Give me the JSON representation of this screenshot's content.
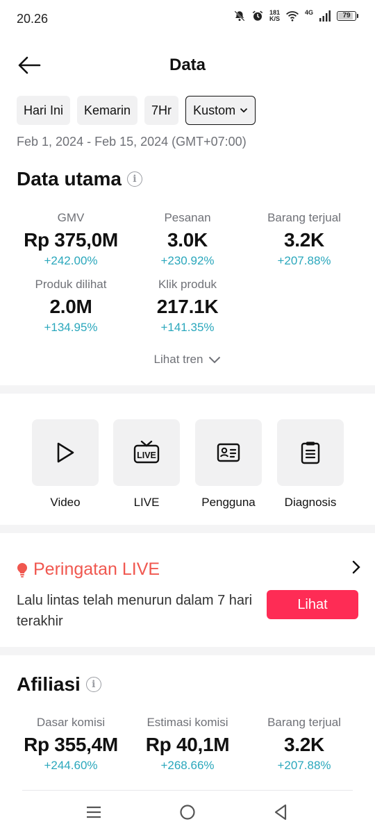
{
  "status": {
    "time": "20.26",
    "net_speed": "181",
    "net_unit": "K/S",
    "network": "4G",
    "battery": "79"
  },
  "header": {
    "title": "Data"
  },
  "date_chips": [
    {
      "label": "Hari Ini"
    },
    {
      "label": "Kemarin"
    },
    {
      "label": "7Hr"
    },
    {
      "label": "Kustom"
    }
  ],
  "date_range": "Feb 1, 2024 - Feb 15, 2024 (GMT+07:00)",
  "main_data": {
    "title": "Data utama",
    "metrics": [
      {
        "label": "GMV",
        "value": "Rp 375,0M",
        "change": "+242.00%"
      },
      {
        "label": "Pesanan",
        "value": "3.0K",
        "change": "+230.92%"
      },
      {
        "label": "Barang terjual",
        "value": "3.2K",
        "change": "+207.88%"
      },
      {
        "label": "Produk dilihat",
        "value": "2.0M",
        "change": "+134.95%"
      },
      {
        "label": "Klik produk",
        "value": "217.1K",
        "change": "+141.35%"
      }
    ],
    "trend_link": "Lihat tren"
  },
  "tools": [
    {
      "label": "Video",
      "icon": "play-icon"
    },
    {
      "label": "LIVE",
      "icon": "live-tv-icon"
    },
    {
      "label": "Pengguna",
      "icon": "user-card-icon"
    },
    {
      "label": "Diagnosis",
      "icon": "clipboard-icon"
    }
  ],
  "live_alert": {
    "title": "Peringatan LIVE",
    "text": "Lalu lintas telah menurun dalam 7 hari terakhir",
    "button": "Lihat",
    "accent": "#f0574f",
    "button_color": "#fe2c55"
  },
  "affiliate": {
    "title": "Afiliasi",
    "metrics": [
      {
        "label": "Dasar komisi",
        "value": "Rp 355,4M",
        "change": "+244.60%"
      },
      {
        "label": "Estimasi komisi",
        "value": "Rp 40,1M",
        "change": "+268.66%"
      },
      {
        "label": "Barang terjual",
        "value": "3.2K",
        "change": "+207.88%"
      }
    ]
  },
  "colors": {
    "positive_change": "#2aa7bc",
    "muted_text": "#6f7177"
  }
}
